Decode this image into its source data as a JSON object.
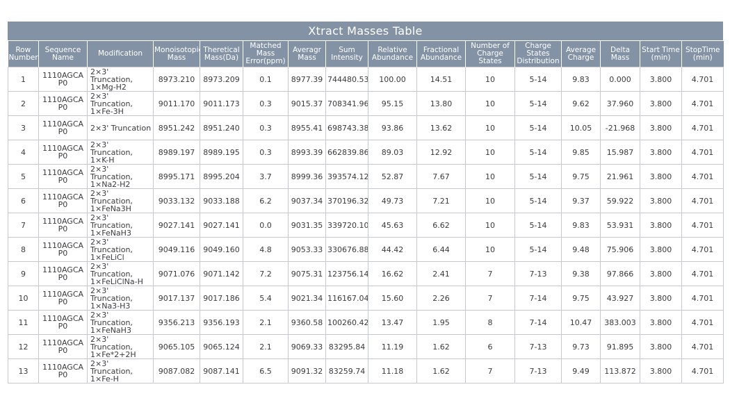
{
  "title": "Xtract Masses Table",
  "columns": [
    [
      "Row",
      "Number"
    ],
    [
      "Sequence",
      "Name"
    ],
    [
      "Modification"
    ],
    [
      "Monoisotopic",
      "Mass"
    ],
    [
      "Theretical",
      "Mass(Da)"
    ],
    [
      "Matched Mass",
      "Error(ppm)"
    ],
    [
      "Averagr",
      "Mass"
    ],
    [
      "Sum",
      "Intensity"
    ],
    [
      "Relative",
      "Abundance"
    ],
    [
      "Fractional",
      "Abundance"
    ],
    [
      "Number of",
      "Charge States"
    ],
    [
      "Charge States",
      "Distribution"
    ],
    [
      "Average",
      "Charge"
    ],
    [
      "Delta Mass"
    ],
    [
      "Start Time",
      "(min)"
    ],
    [
      "StopTime",
      "(min)"
    ]
  ],
  "rows": [
    [
      "1",
      [
        "1110AGCA",
        "P0"
      ],
      [
        "2×3' Truncation,",
        "1×Mg-H2"
      ],
      "8973.210",
      "8973.209",
      "0.1",
      "8977.39",
      "744480.53",
      "100.00",
      "14.51",
      "10",
      "5-14",
      "9.83",
      "0.000",
      "3.800",
      "4.701"
    ],
    [
      "2",
      [
        "1110AGCA",
        "P0"
      ],
      [
        "2×3' Truncation,",
        "1×Fe-3H"
      ],
      "9011.170",
      "9011.173",
      "0.3",
      "9015.37",
      "708341.96",
      "95.15",
      "13.80",
      "10",
      "5-14",
      "9.62",
      "37.960",
      "3.800",
      "4.701"
    ],
    [
      "3",
      [
        "1110AGCA",
        "P0"
      ],
      [
        "2×3' Truncation"
      ],
      "8951.242",
      "8951.240",
      "0.3",
      "8955.41",
      "698743.38",
      "93.86",
      "13.62",
      "10",
      "5-14",
      "10.05",
      "-21.968",
      "3.800",
      "4.701"
    ],
    [
      "4",
      [
        "1110AGCA",
        "P0"
      ],
      [
        "2×3' Truncation,",
        "1×K-H"
      ],
      "8989.197",
      "8989.195",
      "0.3",
      "8993.39",
      "662839.86",
      "89.03",
      "12.92",
      "10",
      "5-14",
      "9.85",
      "15.987",
      "3.800",
      "4.701"
    ],
    [
      "5",
      [
        "1110AGCA",
        "P0"
      ],
      [
        "2×3' Truncation,",
        "1×Na2-H2"
      ],
      "8995.171",
      "8995.204",
      "3.7",
      "8999.36",
      "393574.12",
      "52.87",
      "7.67",
      "10",
      "5-14",
      "9.75",
      "21.961",
      "3.800",
      "4.701"
    ],
    [
      "6",
      [
        "1110AGCA",
        "P0"
      ],
      [
        "2×3' Truncation,",
        "1×FeNa3H"
      ],
      "9033.132",
      "9033.188",
      "6.2",
      "9037.34",
      "370196.32",
      "49.73",
      "7.21",
      "10",
      "5-14",
      "9.37",
      "59.922",
      "3.800",
      "4.701"
    ],
    [
      "7",
      [
        "1110AGCA",
        "P0"
      ],
      [
        "2×3' Truncation,",
        "1×FeNaH3"
      ],
      "9027.141",
      "9027.141",
      "0.0",
      "9031.35",
      "339720.10",
      "45.63",
      "6.62",
      "10",
      "5-14",
      "9.83",
      "53.931",
      "3.800",
      "4.701"
    ],
    [
      "8",
      [
        "1110AGCA",
        "P0"
      ],
      [
        "2×3' Truncation,",
        "1×FeLiCl"
      ],
      "9049.116",
      "9049.160",
      "4.8",
      "9053.33",
      "330676.88",
      "44.42",
      "6.44",
      "10",
      "5-14",
      "9.48",
      "75.906",
      "3.800",
      "4.701"
    ],
    [
      "9",
      [
        "1110AGCA",
        "P0"
      ],
      [
        "2×3' Truncation,",
        "1×FeLiClNa-H"
      ],
      "9071.076",
      "9071.142",
      "7.2",
      "9075.31",
      "123756.14",
      "16.62",
      "2.41",
      "7",
      "7-13",
      "9.38",
      "97.866",
      "3.800",
      "4.701"
    ],
    [
      "10",
      [
        "1110AGCA",
        "P0"
      ],
      [
        "2×3' Truncation,",
        "1×Na3-H3"
      ],
      "9017.137",
      "9017.186",
      "5.4",
      "9021.34",
      "116167.04",
      "15.60",
      "2.26",
      "7",
      "7-14",
      "9.75",
      "43.927",
      "3.800",
      "4.701"
    ],
    [
      "11",
      [
        "1110AGCA",
        "P0"
      ],
      [
        "2×3' Truncation,",
        "1×FeNaH3"
      ],
      "9356.213",
      "9356.193",
      "2.1",
      "9360.58",
      "100260.42",
      "13.47",
      "1.95",
      "8",
      "7-14",
      "10.47",
      "383.003",
      "3.800",
      "4.701"
    ],
    [
      "12",
      [
        "1110AGCA",
        "P0"
      ],
      [
        "2×3' Truncation,",
        "1×Fe*2+2H"
      ],
      "9065.105",
      "9065.124",
      "2.1",
      "9069.33",
      "83295.84",
      "11.19",
      "1.62",
      "6",
      "7-13",
      "9.73",
      "91.895",
      "3.800",
      "4.701"
    ],
    [
      "13",
      [
        "1110AGCA",
        "P0"
      ],
      [
        "2×3' Truncation,",
        "1×Fe-H"
      ],
      "9087.082",
      "9087.141",
      "6.5",
      "9091.32",
      "83259.74",
      "11.18",
      "1.62",
      "7",
      "7-13",
      "9.49",
      "113.872",
      "3.800",
      "4.701"
    ]
  ],
  "colors": {
    "header_bg": "#8492a6",
    "header_text": "#ffffff",
    "border": "#c4c8cf",
    "text": "#3a3a3a"
  }
}
